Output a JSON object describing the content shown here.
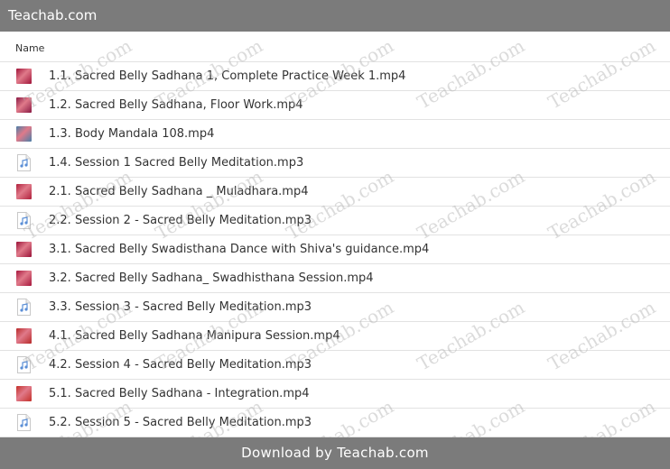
{
  "header": {
    "title": "Teachab.com"
  },
  "table": {
    "column_name": "Name",
    "files": [
      {
        "name": "1.1. Sacred Belly Sadhana 1, Complete Practice Week 1.mp4",
        "kind": "video",
        "thumb_color": "#a0143a"
      },
      {
        "name": "1.2. Sacred Belly Sadhana, Floor Work.mp4",
        "kind": "video",
        "thumb_color": "#8a1a44"
      },
      {
        "name": "1.3. Body Mandala 108.mp4",
        "kind": "video",
        "thumb_color": "#4a7fa8"
      },
      {
        "name": "1.4. Session 1 Sacred Belly Meditation.mp3",
        "kind": "audio"
      },
      {
        "name": "2.1. Sacred Belly Sadhana _ Muladhara.mp4",
        "kind": "video",
        "thumb_color": "#b0203c"
      },
      {
        "name": "2.2. Session 2 - Sacred Belly Meditation.mp3",
        "kind": "audio"
      },
      {
        "name": "3.1. Sacred Belly Swadisthana Dance with Shiva's guidance.mp4",
        "kind": "video",
        "thumb_color": "#9a1238"
      },
      {
        "name": "3.2. Sacred Belly Sadhana_ Swadhisthana Session.mp4",
        "kind": "video",
        "thumb_color": "#a8183e"
      },
      {
        "name": "3.3. Session 3 - Sacred Belly Meditation.mp3",
        "kind": "audio"
      },
      {
        "name": "4.1. Sacred Belly Sadhana Manipura Session.mp4",
        "kind": "video",
        "thumb_color": "#b82a2a"
      },
      {
        "name": "4.2. Session 4 - Sacred Belly Meditation.mp3",
        "kind": "audio"
      },
      {
        "name": "5.1. Sacred Belly Sadhana - Integration.mp4",
        "kind": "video",
        "thumb_color": "#c4302a"
      },
      {
        "name": "5.2. Session 5 - Sacred Belly Meditation.mp3",
        "kind": "audio"
      }
    ]
  },
  "footer": {
    "label": "Download by Teachab.com"
  },
  "watermark": {
    "text": "Teachab.com"
  },
  "colors": {
    "bar": "#7b7b7b",
    "row_border": "#e2e2e2",
    "audio_note": "#5b8fd6"
  }
}
